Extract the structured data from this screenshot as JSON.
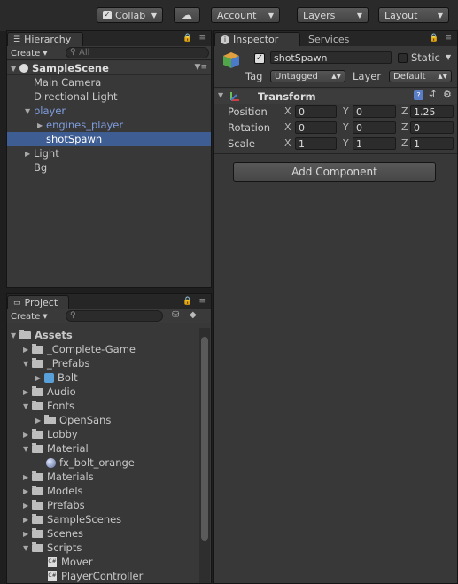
{
  "toolbar": {
    "collab": "Collab",
    "account": "Account",
    "layers": "Layers",
    "layout": "Layout"
  },
  "hierarchy": {
    "tab": "Hierarchy",
    "create": "Create",
    "search_placeholder": "All",
    "scene": "SampleScene",
    "items": [
      {
        "label": "Main Camera"
      },
      {
        "label": "Directional Light"
      },
      {
        "label": "player"
      },
      {
        "label": "engines_player"
      },
      {
        "label": "shotSpawn"
      },
      {
        "label": "Light"
      },
      {
        "label": "Bg"
      }
    ]
  },
  "project": {
    "tab": "Project",
    "create": "Create",
    "tree": [
      {
        "label": "Assets"
      },
      {
        "label": "_Complete-Game"
      },
      {
        "label": "_Prefabs"
      },
      {
        "label": "Bolt"
      },
      {
        "label": "Audio"
      },
      {
        "label": "Fonts"
      },
      {
        "label": "OpenSans"
      },
      {
        "label": "Lobby"
      },
      {
        "label": "Material"
      },
      {
        "label": "fx_bolt_orange"
      },
      {
        "label": "Materials"
      },
      {
        "label": "Models"
      },
      {
        "label": "Prefabs"
      },
      {
        "label": "SampleScenes"
      },
      {
        "label": "Scenes"
      },
      {
        "label": "Scripts"
      },
      {
        "label": "Mover"
      },
      {
        "label": "PlayerController"
      }
    ]
  },
  "inspector": {
    "tab": "Inspector",
    "tab2": "Services",
    "object_name": "shotSpawn",
    "static_label": "Static",
    "tag_label": "Tag",
    "tag_value": "Untagged",
    "layer_label": "Layer",
    "layer_value": "Default",
    "transform_title": "Transform",
    "position_label": "Position",
    "rotation_label": "Rotation",
    "scale_label": "Scale",
    "axis_x": "X",
    "axis_y": "Y",
    "axis_z": "Z",
    "position": {
      "x": "0",
      "y": "0",
      "z": "1.25"
    },
    "rotation": {
      "x": "0",
      "y": "0",
      "z": "0"
    },
    "scale": {
      "x": "1",
      "y": "1",
      "z": "1"
    },
    "add_component": "Add Component"
  }
}
